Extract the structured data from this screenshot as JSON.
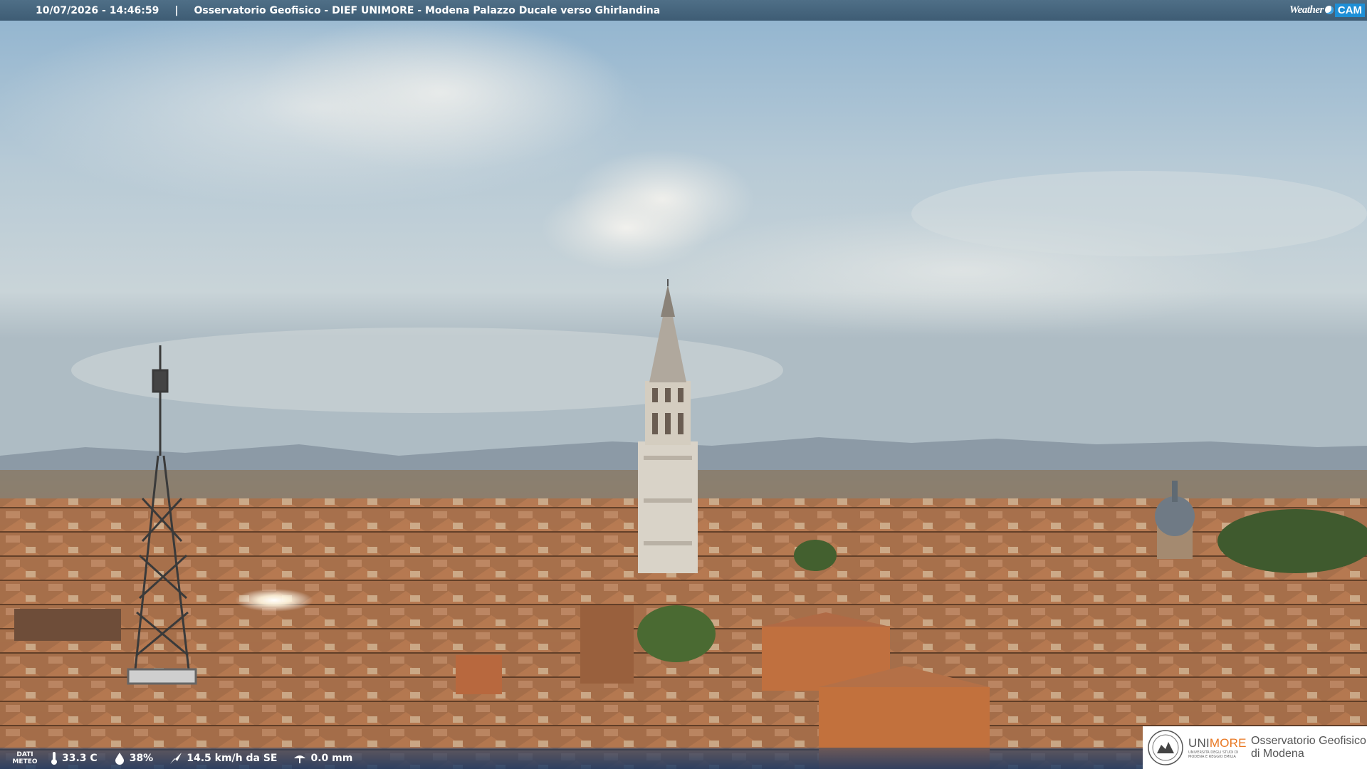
{
  "header": {
    "timestamp": "10/07/2026 - 14:46:59",
    "separator": "|",
    "title": "Osservatorio Geofisico - DIEF UNIMORE - Modena Palazzo Ducale verso Ghirlandina",
    "logo_weather": "Weather",
    "logo_cam": "CAM"
  },
  "meteo": {
    "label_line1": "DATI",
    "label_line2": "METEO",
    "temperature": "33.3 C",
    "humidity": "38%",
    "wind": "14.5 km/h da SE",
    "rain": "0.0 mm"
  },
  "logo_card": {
    "uni_name_a": "UNI",
    "uni_name_b": "MORE",
    "uni_sub": "UNIVERSITÀ DEGLI STUDI DI MODENA E REGGIO EMILIA",
    "obs_line1": "Osservatorio Geofisico",
    "obs_line2": "di Modena"
  },
  "colors": {
    "bar": "#3e5c74",
    "cam_blue": "#1e8fd6",
    "unimore_orange": "#e87722"
  }
}
